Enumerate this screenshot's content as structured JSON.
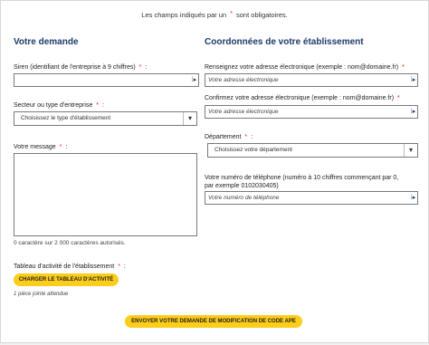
{
  "notice": {
    "prefix": "Les champs indiqués par un",
    "marker": "*",
    "suffix": "sont obligatoires."
  },
  "left": {
    "title": "Votre demande",
    "siren": {
      "label": "Siren (identifiant de l'entreprise à 9 chiffres)",
      "value": ""
    },
    "secteur": {
      "label": "Secteur ou type d'entreprise",
      "selected": "Choisissez le type d'établissement"
    },
    "message": {
      "label": "Votre message",
      "value": "",
      "counter": "0 caractère sur 2 000 caractères autorisés."
    },
    "tableau": {
      "label": "Tableau d'activité de l'établissement",
      "button": "CHARGER LE TABLEAU D'ACTIVITÉ",
      "hint": "1 pièce jointe attendue"
    }
  },
  "right": {
    "title": "Coordonnées de votre établissement",
    "email": {
      "label": "Renseignez votre adresse électronique (exemple : nom@domaine.fr)",
      "placeholder": "Votre adresse électronique"
    },
    "email_confirm": {
      "label": "Confirmez votre adresse électronique (exemple : nom@domaine.fr)",
      "placeholder": "Votre adresse électronique"
    },
    "departement": {
      "label": "Département",
      "selected": "Choisissez votre département"
    },
    "phone": {
      "label_line1": "Votre numéro de téléphone (numéro à 10 chiffres commençant par 0,",
      "label_line2": "par exemple 0102030405)",
      "placeholder": "Votre numéro de téléphone"
    }
  },
  "submit": {
    "label": "ENVOYER VOTRE DEMANDE DE MODIFICATION DE CODE APE"
  },
  "required_marker": "*",
  "input_addon_glyph": "⁞▸",
  "select_arrow_glyph": "▾",
  "colors": {
    "accent_button": "#fdcd1b",
    "section_title": "#1d3a68",
    "required": "#e2231a"
  }
}
